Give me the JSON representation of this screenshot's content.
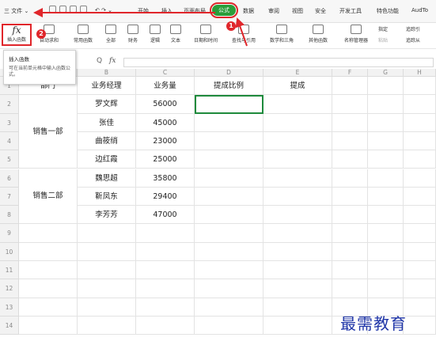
{
  "menubar": {
    "file_label": "三 文件 ⌄",
    "undo_redo": "↶ ↷ ⌄",
    "tabs": [
      "开始",
      "插入",
      "页面布局",
      "公式",
      "数据",
      "审阅",
      "视图",
      "安全",
      "开发工具",
      "特色功能",
      "AudTo"
    ]
  },
  "ribbon": {
    "insert_function": {
      "glyph": "fx",
      "label": "插入函数"
    },
    "groups": [
      "自动求和",
      "常用函数",
      "全部",
      "财务",
      "逻辑",
      "文本",
      "日期和时间",
      "查找与引用",
      "数学和三角",
      "其他函数",
      "名称管理器"
    ],
    "small_buttons": [
      "指定",
      "粘贴",
      "追踪引",
      "追踪从"
    ]
  },
  "tooltip": {
    "title": "插入函数",
    "description": "可在当前单元格中输入函数公式。"
  },
  "formulabar": {
    "fx": "fx",
    "zoom_icon": "Q"
  },
  "columns": [
    "A",
    "B",
    "C",
    "D",
    "E",
    "F",
    "G",
    "H"
  ],
  "rows": [
    "1",
    "2",
    "3",
    "4",
    "5",
    "6",
    "7",
    "8",
    "9",
    "10",
    "11",
    "12",
    "13",
    "14"
  ],
  "table": {
    "headers": [
      "部门",
      "业务经理",
      "业务量",
      "提成比例",
      "提成"
    ],
    "dept1": "销售一部",
    "dept2": "销售二部",
    "managers": [
      "罗文辉",
      "张佳",
      "曲筱绡",
      "边红霞",
      "魏思超",
      "靳凤东",
      "李芳芳"
    ],
    "volumes": [
      "56000",
      "45000",
      "23000",
      "25000",
      "35800",
      "29400",
      "47000"
    ]
  },
  "annotations": {
    "badge1": "1",
    "badge2": "2"
  },
  "watermark": "最需教育",
  "colors": {
    "accent_green": "#2a9d3a",
    "highlight_red": "#e0262b",
    "selection_green": "#1e8a3c"
  }
}
